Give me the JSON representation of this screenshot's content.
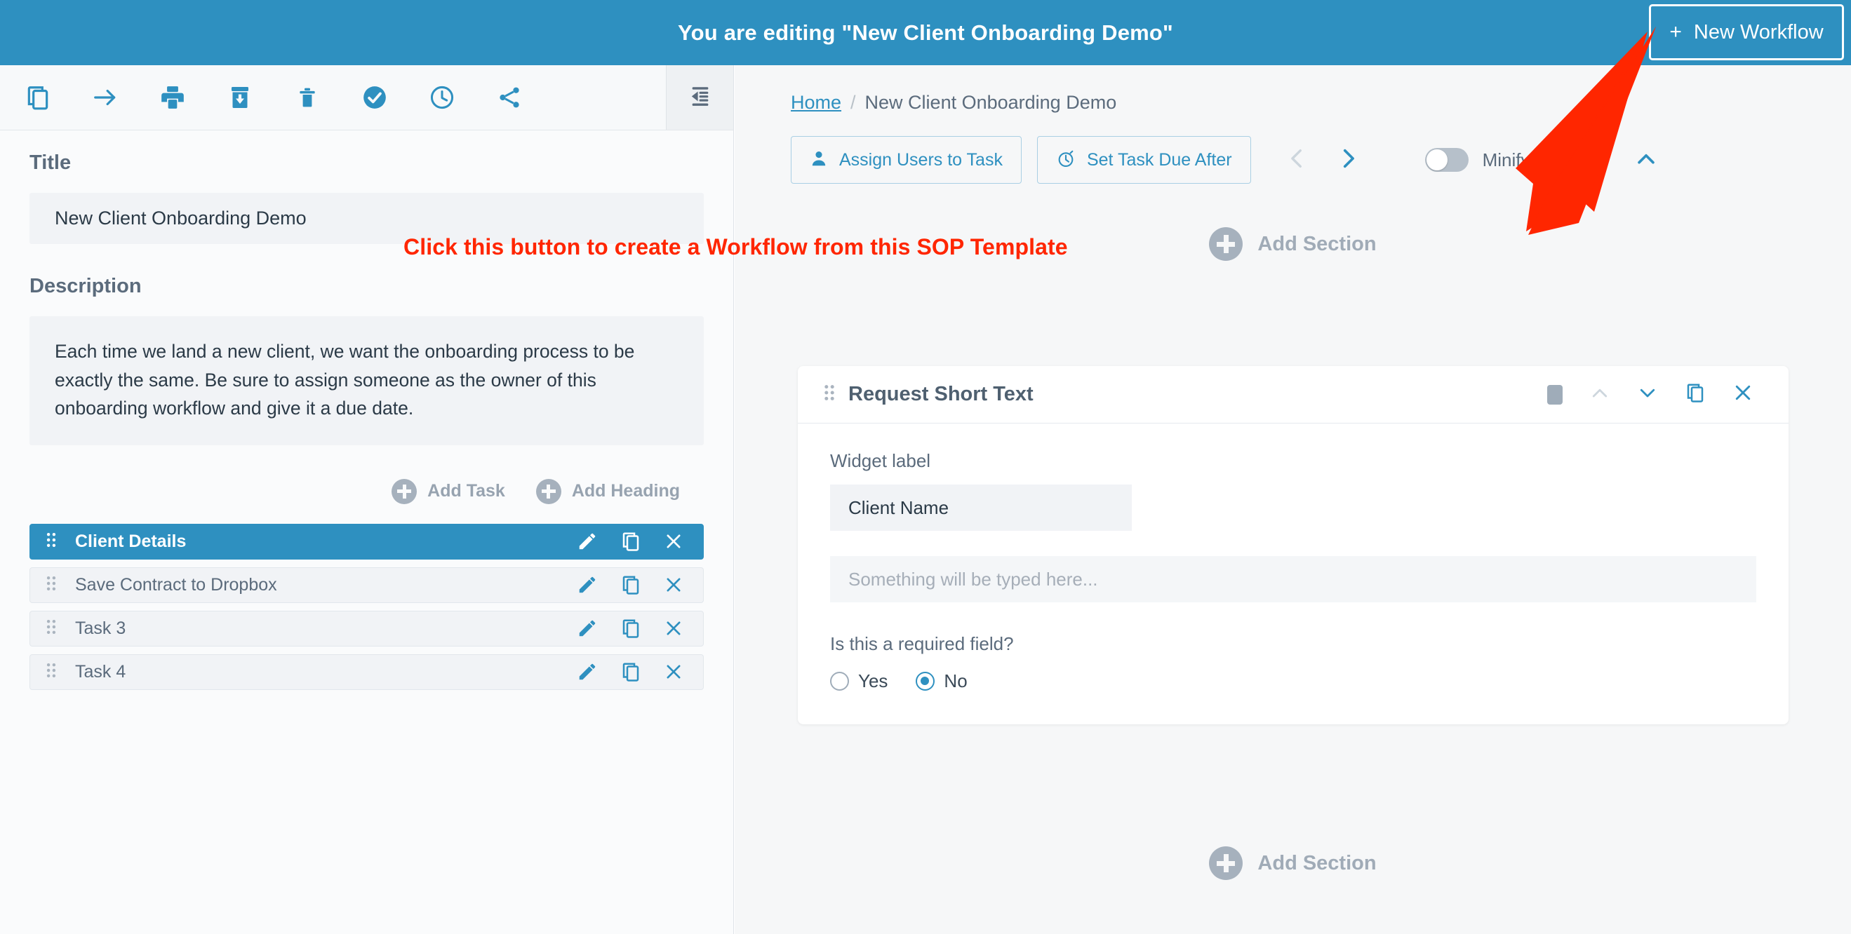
{
  "topbar": {
    "title": "You are editing \"New Client Onboarding Demo\"",
    "new_workflow_plus": "+",
    "new_workflow_label": "New Workflow"
  },
  "annotation": {
    "text": "Click this button to create a Workflow from this SOP Template",
    "color": "#ff2600"
  },
  "left_panel": {
    "toolbar_icons": [
      "copy-icon",
      "arrow-right-icon",
      "print-icon",
      "archive-download-icon",
      "trash-icon",
      "check-circle-icon",
      "clock-icon",
      "share-icon"
    ],
    "collapse_icon": "collapse-sidebar-icon",
    "title_label": "Title",
    "title_value": "New Client Onboarding Demo",
    "description_label": "Description",
    "description_value": "Each time we land a new client, we want the onboarding process to be exactly the same. Be sure to assign someone as the owner of this onboarding workflow and give it a due date.",
    "add_task_label": "Add Task",
    "add_heading_label": "Add Heading",
    "tasks": [
      {
        "name": "Client Details",
        "active": true
      },
      {
        "name": "Save Contract to Dropbox",
        "active": false
      },
      {
        "name": "Task 3",
        "active": false
      },
      {
        "name": "Task 4",
        "active": false
      }
    ],
    "row_action_icons": [
      "pencil-icon",
      "copy-icon",
      "close-icon"
    ]
  },
  "right_panel": {
    "breadcrumb": {
      "home": "Home",
      "separator": "/",
      "current": "New Client Onboarding Demo"
    },
    "actions": [
      {
        "label": "Assign Users to Task",
        "icon": "user-icon"
      },
      {
        "label": "Set Task Due After",
        "icon": "stopwatch-icon"
      }
    ],
    "nav": {
      "prev_icon": "chevron-left-icon",
      "next_icon": "chevron-right-icon"
    },
    "minify": {
      "label": "Minify Sections",
      "enabled": false,
      "collapse_icon": "chevron-up-icon"
    },
    "add_section_top": "Add Section",
    "add_section_bottom": "Add Section",
    "widget": {
      "title": "Request Short Text",
      "head_icons": [
        "grip-icon",
        "square-icon",
        "chevron-up-icon",
        "chevron-down-icon",
        "copy-icon",
        "close-icon"
      ],
      "widget_label": "Widget label",
      "widget_label_value": "Client Name",
      "preview_placeholder": "Something will be typed here...",
      "required_question": "Is this a required field?",
      "options": [
        {
          "label": "Yes",
          "selected": false
        },
        {
          "label": "No",
          "selected": true
        }
      ]
    }
  },
  "colors": {
    "brand_blue": "#2e90c0",
    "annotation_red": "#ff2600",
    "muted_gray": "#a6b1bd",
    "text_slate": "#5b6b7c"
  }
}
